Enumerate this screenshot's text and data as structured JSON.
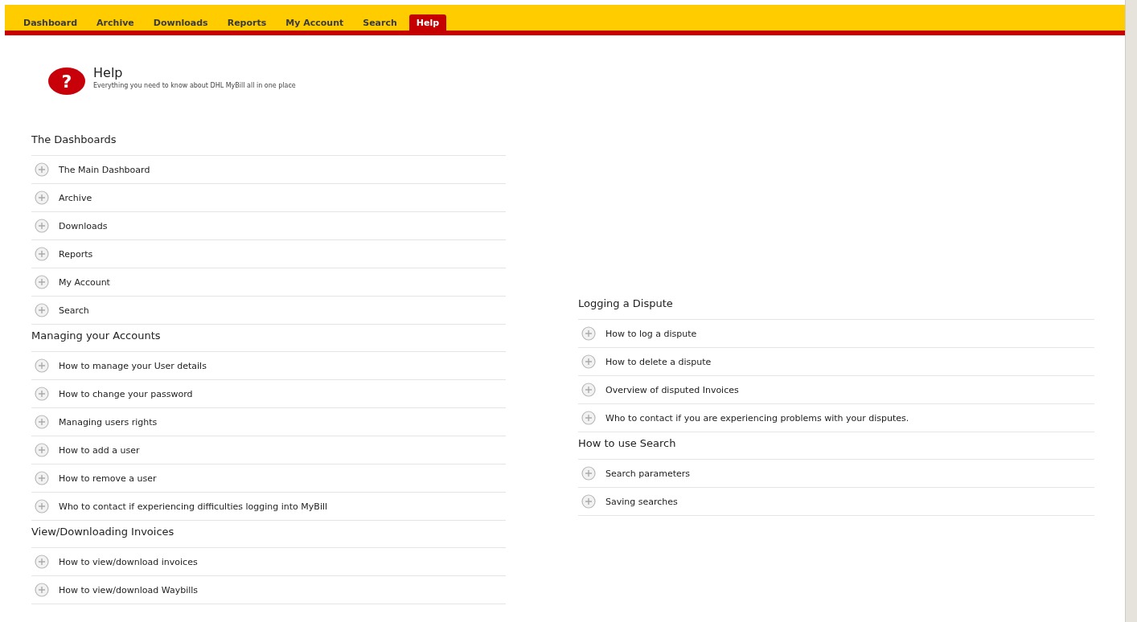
{
  "nav": {
    "tabs": [
      {
        "label": "Dashboard",
        "selected": false
      },
      {
        "label": "Archive",
        "selected": false
      },
      {
        "label": "Downloads",
        "selected": false
      },
      {
        "label": "Reports",
        "selected": false
      },
      {
        "label": "My Account",
        "selected": false
      },
      {
        "label": "Search",
        "selected": false
      },
      {
        "label": "Help",
        "selected": true
      }
    ]
  },
  "header": {
    "icon_text": "?",
    "title": "Help",
    "subtitle": "Everything you need to know about DHL MyBill all in one place"
  },
  "columns": [
    {
      "sections": [
        {
          "title": "The Dashboards",
          "items": [
            "The Main Dashboard",
            "Archive",
            "Downloads",
            "Reports",
            "My Account",
            "Search"
          ]
        },
        {
          "title": "Managing your Accounts",
          "items": [
            "How to manage your User details",
            "How to change your password",
            "Managing users rights",
            "How to add a user",
            "How to remove a user",
            "Who to contact if experiencing difficulties logging into MyBill"
          ]
        },
        {
          "title": "View/Downloading Invoices",
          "items": [
            "How to view/download invoices",
            "How to view/download Waybills"
          ]
        }
      ]
    },
    {
      "sections": [
        {
          "title": "Logging a Dispute",
          "items": [
            "How to log a dispute",
            "How to delete a dispute",
            "Overview of disputed Invoices",
            "Who to contact if you are experiencing problems with your disputes."
          ]
        },
        {
          "title": "How to use Search",
          "items": [
            "Search parameters",
            "Saving searches"
          ]
        }
      ]
    }
  ]
}
